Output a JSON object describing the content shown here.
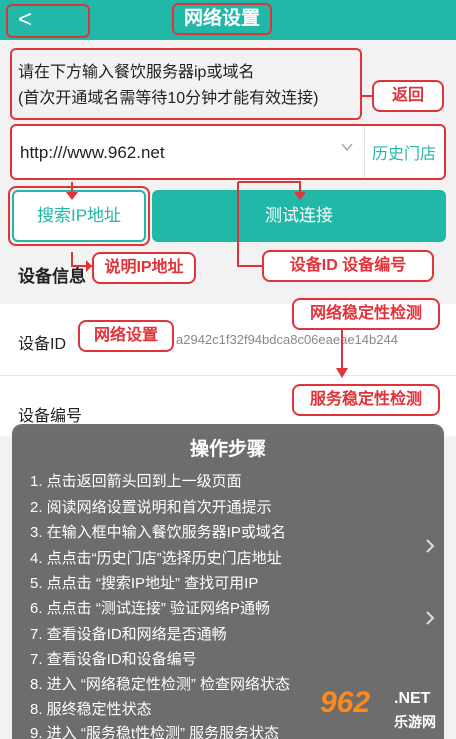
{
  "header": {
    "back_glyph": "<",
    "title": "网络设置"
  },
  "instructions": {
    "line1": "请在下方输入餐饮服务器ip或域名",
    "line2": "(首次开通域名需等待10分钟才能有效连接)"
  },
  "server": {
    "value": "http:///www.962.net",
    "history_label": "历史门店"
  },
  "buttons": {
    "search": "搜索IP地址",
    "test": "测试连接"
  },
  "device_info": {
    "section_title": "设备信息",
    "device_id_label": "设备ID",
    "device_id_value": "a2942c1f32f94bdca8c06eaeae14b244",
    "device_no_label": "设备编号"
  },
  "callouts": {
    "back": "返回",
    "explain_ip": "说明IP地址",
    "device_id_no": "设备ID  设备编号",
    "net_stability": "网络稳定性检测",
    "net_settings": "网络设置",
    "server_stability": "服务稳定性检测"
  },
  "steps": {
    "title": "操作步骤",
    "items": [
      "1.  点击返回箭头回到上一级页面",
      "2.  阅读网络设置说明和首次开通提示",
      "3.  在输入框中输入餐饮服务器IP或域名",
      "4.  点点击“历史门店”选择历史门店地址",
      "5.  点点击 “搜索IP地址” 查找可用IP",
      "6.  点点击 “测试连接” 验证网络P通畅",
      "7.  查看设备ID和网络是否通畅",
      "7.  查看设备ID和设备编号",
      "8.  进入 “网络稳定性检测” 检查网络状态",
      "8.  服终稳定性状态",
      "9.  进入 “服务稳t性检测” 服务服务状态"
    ]
  },
  "watermark": {
    "brand": "962",
    "net": ".NET",
    "sub": "乐游网"
  },
  "colors": {
    "teal": "#21b8a8",
    "red": "#e0333a"
  }
}
